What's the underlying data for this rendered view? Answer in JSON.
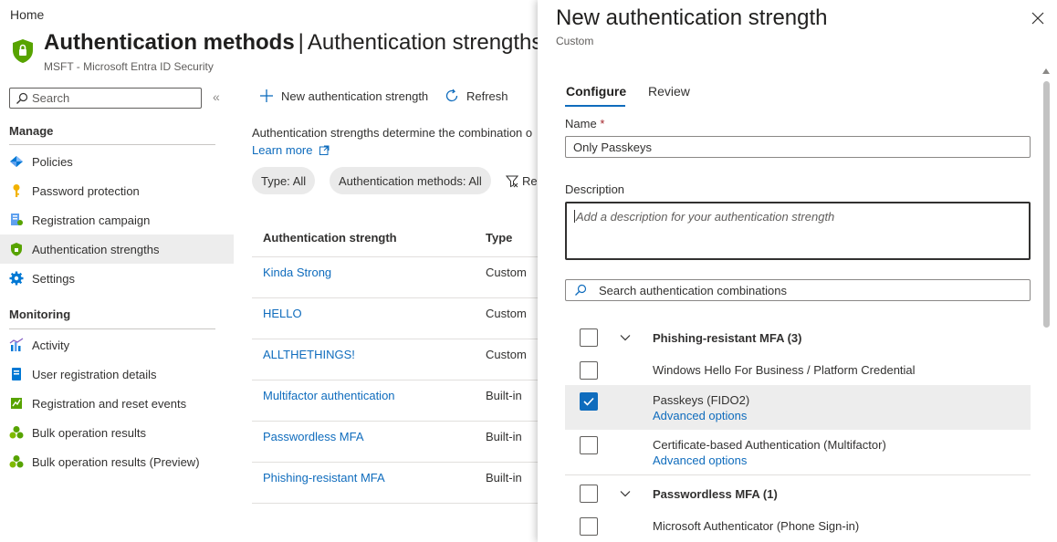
{
  "breadcrumb": "Home",
  "page": {
    "title_main": "Authentication methods",
    "title_sep": "|",
    "title_rest": "Authentication strengths",
    "subtitle": "MSFT - Microsoft Entra ID Security"
  },
  "sidebar": {
    "search_placeholder": "Search",
    "collapse": "«",
    "sections": [
      {
        "label": "Manage"
      },
      {
        "label": "Monitoring"
      }
    ],
    "manage_items": [
      {
        "label": "Policies",
        "icon": "policies-icon"
      },
      {
        "label": "Password protection",
        "icon": "key-icon"
      },
      {
        "label": "Registration campaign",
        "icon": "registration-icon"
      },
      {
        "label": "Authentication strengths",
        "icon": "shield-icon",
        "selected": true
      },
      {
        "label": "Settings",
        "icon": "gear-icon"
      }
    ],
    "monitoring_items": [
      {
        "label": "Activity",
        "icon": "activity-icon"
      },
      {
        "label": "User registration details",
        "icon": "details-icon"
      },
      {
        "label": "Registration and reset events",
        "icon": "events-icon"
      },
      {
        "label": "Bulk operation results",
        "icon": "bulk-icon"
      },
      {
        "label": "Bulk operation results (Preview)",
        "icon": "bulk-icon"
      }
    ]
  },
  "toolbar": {
    "new_label": "New authentication strength",
    "refresh_label": "Refresh"
  },
  "main": {
    "description": "Authentication strengths determine the combination o",
    "learn_more": "Learn more",
    "filters": [
      "Type: All",
      "Authentication methods: All"
    ],
    "reset": "Res",
    "columns": [
      "Authentication strength",
      "Type"
    ],
    "rows": [
      {
        "name": "Kinda Strong",
        "type": "Custom"
      },
      {
        "name": "HELLO",
        "type": "Custom"
      },
      {
        "name": "ALLTHETHINGS!",
        "type": "Custom"
      },
      {
        "name": "Multifactor authentication",
        "type": "Built-in"
      },
      {
        "name": "Passwordless MFA",
        "type": "Built-in"
      },
      {
        "name": "Phishing-resistant MFA",
        "type": "Built-in"
      }
    ]
  },
  "panel": {
    "title": "New authentication strength",
    "subtitle": "Custom",
    "tabs": [
      "Configure",
      "Review"
    ],
    "name_label": "Name",
    "required_mark": "*",
    "name_value": "Only Passkeys",
    "description_label": "Description",
    "description_placeholder": "Add a description for your authentication strength",
    "search_placeholder": "Search authentication combinations",
    "list": [
      {
        "label": "Phishing-resistant MFA (3)",
        "group": true,
        "checked": false
      },
      {
        "label": "Windows Hello For Business / Platform Credential",
        "group": false,
        "checked": false
      },
      {
        "label": "Passkeys (FIDO2)",
        "group": false,
        "checked": true,
        "advanced": "Advanced options"
      },
      {
        "label": "Certificate-based Authentication (Multifactor)",
        "group": false,
        "checked": false,
        "advanced": "Advanced options"
      },
      {
        "label": "Passwordless MFA (1)",
        "group": true,
        "checked": false
      },
      {
        "label": "Microsoft Authenticator (Phone Sign-in)",
        "group": false,
        "checked": false
      }
    ]
  },
  "colors": {
    "accent": "#0f6cbd",
    "selected_bg": "#ededed",
    "shield": "#57a300"
  }
}
